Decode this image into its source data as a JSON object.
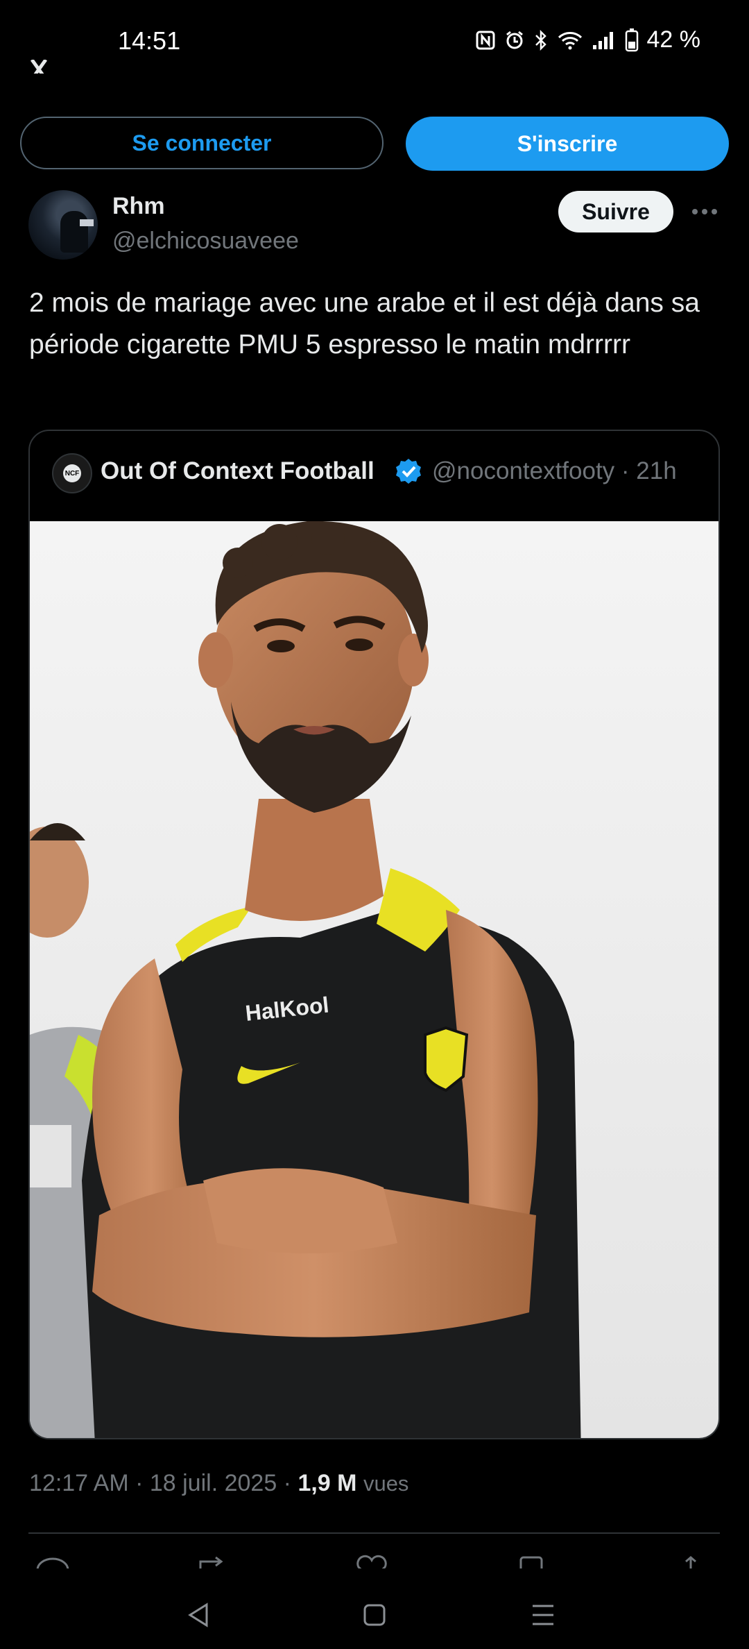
{
  "status_bar": {
    "time": "14:51",
    "battery": "42 %",
    "icons": [
      "nfc-icon",
      "alarm-icon",
      "bluetooth-icon",
      "wifi-icon",
      "signal-icon",
      "battery-icon"
    ]
  },
  "auth": {
    "login_label": "Se connecter",
    "signup_label": "S'inscrire"
  },
  "author": {
    "name": "Rhm",
    "handle": "@elchicosuaveee",
    "follow_label": "Suivre"
  },
  "tweet": {
    "text": "2 mois de mariage avec une arabe et il est déjà dans sa période cigarette PMU 5 espresso le matin mdrrrrr"
  },
  "quote": {
    "name": "Out Of Context Football",
    "handle_time": "@nocontextfooty · 21h",
    "avatar_text": "NCF"
  },
  "meta": {
    "time_date": "12:17 AM · 18 juil. 2025 · ",
    "views_count": "1,9 M",
    "views_label": "vues"
  },
  "colors": {
    "accent": "#1d9bf0",
    "background": "#000000",
    "text": "#e7e9ea",
    "muted": "#71767b"
  }
}
